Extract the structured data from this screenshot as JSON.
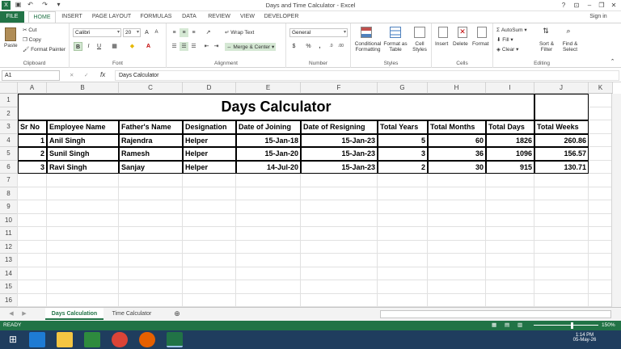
{
  "window": {
    "title": "Days and Time Calculator - Excel",
    "help": "?",
    "signin": "Sign in"
  },
  "tabs": [
    "FILE",
    "HOME",
    "INSERT",
    "PAGE LAYOUT",
    "FORMULAS",
    "DATA",
    "REVIEW",
    "VIEW",
    "DEVELOPER"
  ],
  "ribbon": {
    "clipboard": {
      "paste": "Paste",
      "cut": "Cut",
      "copy": "Copy",
      "format_painter": "Format Painter",
      "label": "Clipboard"
    },
    "font": {
      "name": "Calibri",
      "size": "20",
      "label": "Font",
      "bold": "B",
      "italic": "I",
      "underline": "U"
    },
    "alignment": {
      "wrap": "Wrap Text",
      "merge": "Merge & Center",
      "label": "Alignment"
    },
    "number": {
      "format": "General",
      "currency": "$",
      "percent": "%",
      "comma": ",",
      "label": "Number"
    },
    "styles": {
      "conditional": "Conditional Formatting",
      "format_table": "Format as Table",
      "cell_styles": "Cell Styles",
      "label": "Styles"
    },
    "cells": {
      "insert": "Insert",
      "delete": "Delete",
      "format": "Format",
      "label": "Cells"
    },
    "editing": {
      "autosum": "AutoSum",
      "fill": "Fill",
      "clear": "Clear",
      "sort": "Sort & Filter",
      "find": "Find & Select",
      "label": "Editing"
    }
  },
  "formula_bar": {
    "name_box": "A1",
    "fx": "fx",
    "content": "Days Calculator"
  },
  "columns": [
    "A",
    "B",
    "C",
    "D",
    "E",
    "F",
    "G",
    "H",
    "I",
    "J",
    "K"
  ],
  "rows": [
    "1",
    "2",
    "3",
    "4",
    "5",
    "6",
    "7",
    "8",
    "9",
    "10",
    "11",
    "12",
    "13",
    "14",
    "15",
    "16"
  ],
  "sheet": {
    "title": "Days Calculator",
    "headers": [
      "Sr No",
      "Employee Name",
      "Father's Name",
      "Designation",
      "Date of Joining",
      "Date of Resigning",
      "Total Years",
      "Total Months",
      "Total Days",
      "Total Weeks"
    ],
    "data": [
      [
        "1",
        "Anil Singh",
        "Rajendra",
        "Helper",
        "15-Jan-18",
        "15-Jan-23",
        "5",
        "60",
        "1826",
        "260.86"
      ],
      [
        "2",
        "Sunil Singh",
        "Ramesh",
        "Helper",
        "15-Jan-20",
        "15-Jan-23",
        "3",
        "36",
        "1096",
        "156.57"
      ],
      [
        "3",
        "Ravi Singh",
        "Sanjay",
        "Helper",
        "14-Jul-20",
        "15-Jan-23",
        "2",
        "30",
        "915",
        "130.71"
      ]
    ]
  },
  "sheet_tabs": [
    "Days Calculation",
    "Time Calculator"
  ],
  "status": {
    "mode": "READY",
    "zoom": "150%"
  },
  "taskbar": {
    "time": "1:14 PM",
    "date": "05-May-26"
  },
  "colors": {
    "excel_green": "#217346",
    "taskbar": "#1f3d5e"
  }
}
